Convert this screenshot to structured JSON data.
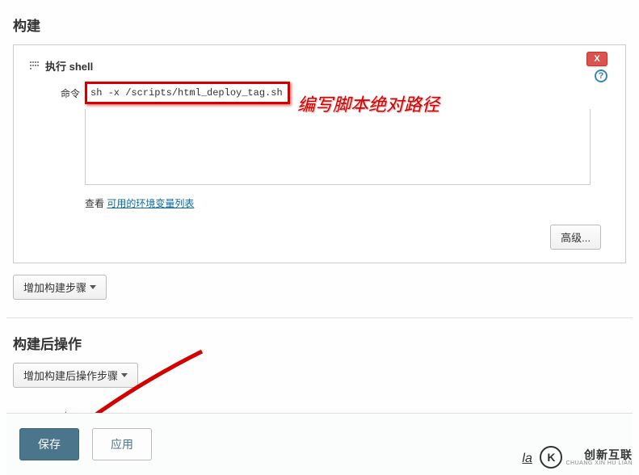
{
  "build": {
    "title": "构建",
    "block_title": "执行 shell",
    "close_label": "X",
    "help_label": "?",
    "command_label": "命令",
    "command_value": "sh -x /scripts/html_deploy_tag.sh",
    "annotation": "编写脚本绝对路径",
    "see_prefix": "查看 ",
    "see_link": "可用的环境变量列表",
    "advanced_label": "高级...",
    "add_step_label": "增加构建步骤"
  },
  "post_build": {
    "title": "构建后操作",
    "add_step_label": "增加构建后操作步骤"
  },
  "footer": {
    "save_label": "保存",
    "apply_label": "应用"
  },
  "brand": {
    "cn": "创新互联",
    "en": "CHUANG XIN HU LIAN",
    "mark": "K"
  },
  "edit_icon_char": "la"
}
